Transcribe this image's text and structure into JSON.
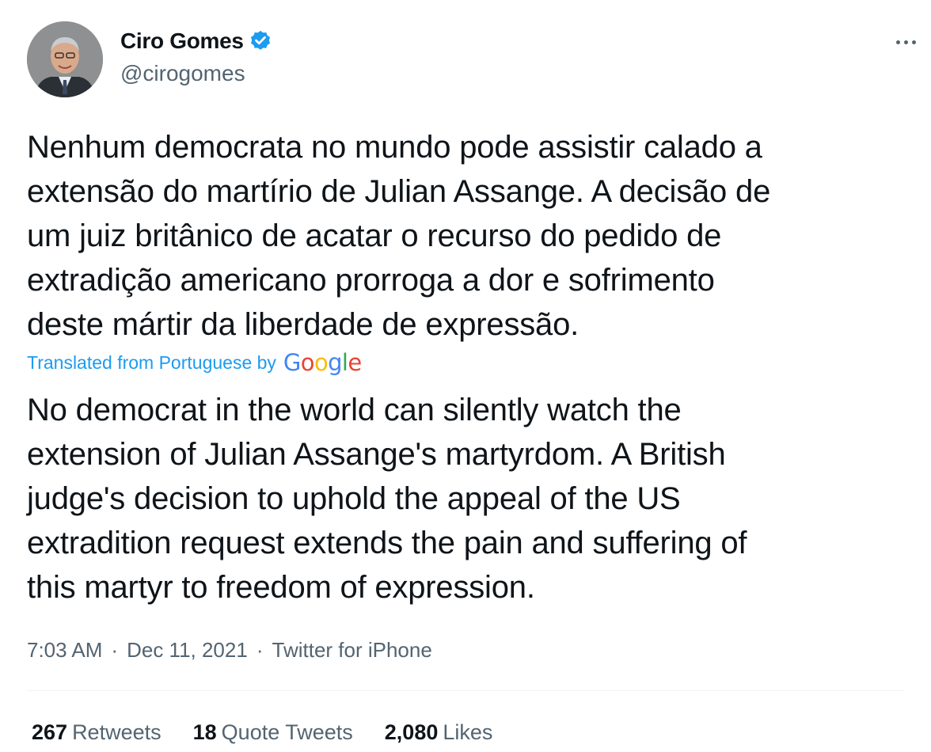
{
  "author": {
    "name": "Ciro Gomes",
    "handle": "@cirogomes",
    "verified": true
  },
  "tweet": {
    "original_text": "Nenhum democrata no mundo pode assistir calado a\nextensão do martírio de Julian Assange. A decisão de\num juiz britânico de acatar o recurso do pedido de\nextradição americano prorroga a dor e sofrimento\ndeste mártir da liberdade de expressão.",
    "translated_label": "Translated from Portuguese by",
    "translator_logo": "Google",
    "translation_text": "No democrat in the world can silently watch the\nextension of Julian Assange's martyrdom. A British\njudge's decision to uphold the appeal of the US\nextradition request extends the pain and suffering of\nthis martyr to freedom of expression."
  },
  "meta": {
    "time": "7:03 AM",
    "separator": "·",
    "date": "Dec 11, 2021",
    "source": "Twitter for iPhone"
  },
  "stats": {
    "retweets": {
      "count": "267",
      "label": "Retweets"
    },
    "quote_tweets": {
      "count": "18",
      "label": "Quote Tweets"
    },
    "likes": {
      "count": "2,080",
      "label": "Likes"
    }
  },
  "icons": {
    "verified": "verified-badge-icon",
    "more": "more-options-icon"
  },
  "colors": {
    "accent": "#1d9bf0",
    "secondary_text": "#536471",
    "primary_text": "#0f1419",
    "google_blue": "#4285F4",
    "google_red": "#EA4335",
    "google_yellow": "#FBBC05",
    "google_green": "#34A853"
  }
}
